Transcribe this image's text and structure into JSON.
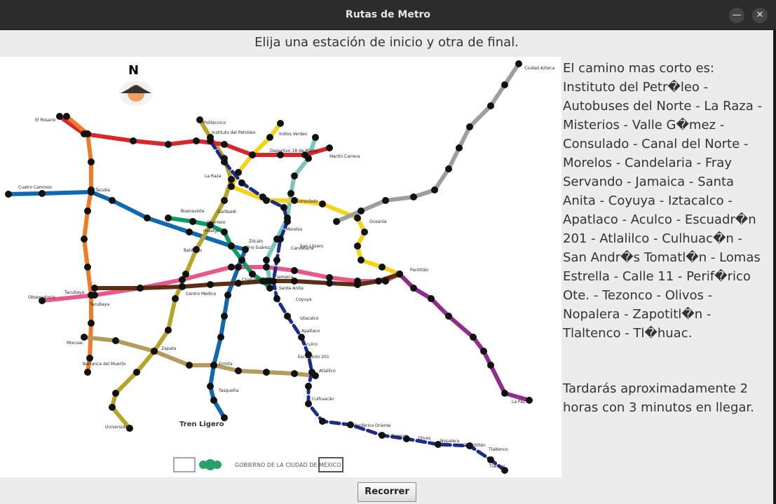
{
  "window": {
    "title": "Rutas de Metro",
    "minimize": "—",
    "close": "✕"
  },
  "instructions": "Elija una estación de inicio y otra de final.",
  "map": {
    "north": "N",
    "north_icon": "compass-icon",
    "tren_ligero": "Tren Ligero",
    "footer_gov": "GOBIERNO DE LA CIUDAD DE MÉXICO",
    "line_colors": {
      "l1": "#e8588c",
      "l2": "#0f68b0",
      "l3": "#b6a52b",
      "l4": "#7cc5bb",
      "l5": "#f7d217",
      "l6": "#d8262a",
      "l7": "#f07a25",
      "l8": "#0e9b60",
      "l9": "#5c2e13",
      "la": "#8f2c8c",
      "lb": "#9aa09e",
      "l12": "#b49b5d",
      "route": "#1c2c8c"
    },
    "labels": {
      "el_rosario": "El Rosario",
      "politecnico": "Politécnico",
      "ciudad_azteca": "Ciudad Azteca",
      "indios_verdes": "Indios Verdes",
      "martin_carrera": "Martín Carrera",
      "instituto": "Instituto del Petróleo",
      "la_raza": "La Raza",
      "deportivo": "Deportivo 18 de Marzo",
      "consulado": "Consulado",
      "morelos": "Morelos",
      "oceania": "Oceanía",
      "pantitlan": "Pantitlán",
      "cuatro_caminos": "Cuatro Caminos",
      "tacuba": "Tacuba",
      "tacubaya": "Tacubaya",
      "observatorio": "Observatorio",
      "chabacano": "Chabacano",
      "santa_anita": "Santa Anita",
      "escuadron": "Escuadrón 201",
      "atlalilco": "Atlalilco",
      "mixcoac": "Mixcoac",
      "zapata": "Zapata",
      "ermita": "Ermita",
      "tlahuac": "Tláhuac",
      "la_paz": "La Paz",
      "universidad": "Universidad",
      "tasquena": "Tasqueña",
      "barranca": "Barranca del Muerto",
      "salto": "Centro Médico",
      "zocalo": "Zócalo",
      "balderas": "Balderas",
      "pino_suarez": "Pino Suárez",
      "hidalgo": "Hidalgo",
      "candelaria": "Candelaria",
      "jamaica": "Jamaica",
      "san_lazaro": "San Lázaro",
      "coyuya": "Coyuya",
      "iztacalco": "Iztacalco",
      "apatlaco": "Apatlaco",
      "aculco": "Aculco",
      "culhuacan": "Culhuacán",
      "periferico": "Periférico Oriente",
      "olivos": "Olivos",
      "zapotitlan": "Zapotitlán",
      "tlaltenco": "Tlaltenco",
      "buenavista": "Buenavista",
      "garibaldi": "Garibaldi",
      "guerrero": "Guerrero",
      "tezonco": "Tezonco",
      "nopalera": "Nopalera",
      "tacubaya2": "Tacubaya"
    }
  },
  "result": {
    "heading": "El camino mas corto es:",
    "path": "Instituto del Petr�leo - Autobuses del Norte - La Raza - Misterios - Valle G�mez - Consulado - Canal del Norte - Morelos - Candelaria - Fray Servando - Jamaica - Santa Anita - Coyuya - Iztacalco - Apatlaco - Aculco - Escuadr�n 201 - Atlalilco - Culhuac�n - San Andr�s Tomatl�n - Lomas Estrella - Calle 11 - Perif�rico Ote. - Tezonco - Olivos - Nopalera - Zapotitl�n - Tlaltenco - Tl�huac.",
    "time": "Tardarás aproximadamente 2 horas con 3 minutos en llegar."
  },
  "button": {
    "label": "Recorrer"
  }
}
